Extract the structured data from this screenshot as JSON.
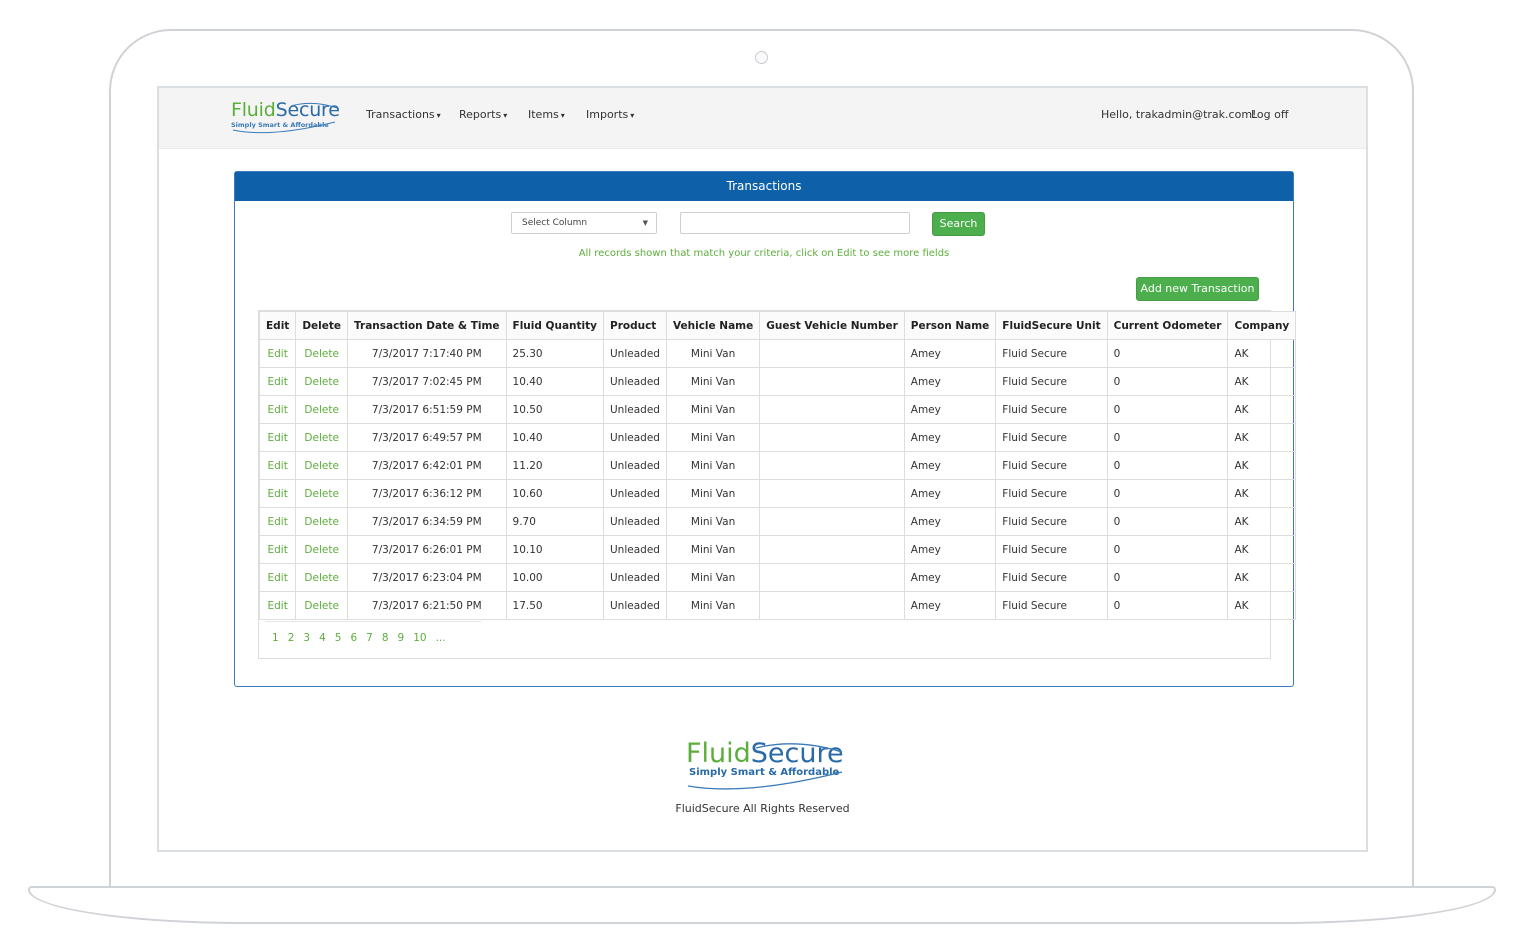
{
  "nav": {
    "logo_word_a": "Fluid",
    "logo_word_b": "Secure",
    "logo_tagline": "Simply Smart & Affordable",
    "menu": [
      "Transactions",
      "Reports",
      "Items",
      "Imports"
    ],
    "greeting": "Hello, trakadmin@trak.com!",
    "logoff": "Log off"
  },
  "panel": {
    "title": "Transactions",
    "select_column": "Select Column",
    "search_value": "",
    "search_button": "Search",
    "hint": "All records shown that match your criteria, click on Edit to see more fields",
    "add_button": "Add new Transaction"
  },
  "table": {
    "headers": [
      "Edit",
      "Delete",
      "Transaction Date & Time",
      "Fluid Quantity",
      "Product",
      "Vehicle Name",
      "Guest Vehicle Number",
      "Person Name",
      "FluidSecure Unit",
      "Current Odometer",
      "Company"
    ],
    "rows": [
      [
        "Edit",
        "Delete",
        "7/3/2017 7:17:40 PM",
        "25.30",
        "Unleaded",
        "Mini Van",
        "",
        "Amey",
        "Fluid Secure",
        "0",
        "AK"
      ],
      [
        "Edit",
        "Delete",
        "7/3/2017 7:02:45 PM",
        "10.40",
        "Unleaded",
        "Mini Van",
        "",
        "Amey",
        "Fluid Secure",
        "0",
        "AK"
      ],
      [
        "Edit",
        "Delete",
        "7/3/2017 6:51:59 PM",
        "10.50",
        "Unleaded",
        "Mini Van",
        "",
        "Amey",
        "Fluid Secure",
        "0",
        "AK"
      ],
      [
        "Edit",
        "Delete",
        "7/3/2017 6:49:57 PM",
        "10.40",
        "Unleaded",
        "Mini Van",
        "",
        "Amey",
        "Fluid Secure",
        "0",
        "AK"
      ],
      [
        "Edit",
        "Delete",
        "7/3/2017 6:42:01 PM",
        "11.20",
        "Unleaded",
        "Mini Van",
        "",
        "Amey",
        "Fluid Secure",
        "0",
        "AK"
      ],
      [
        "Edit",
        "Delete",
        "7/3/2017 6:36:12 PM",
        "10.60",
        "Unleaded",
        "Mini Van",
        "",
        "Amey",
        "Fluid Secure",
        "0",
        "AK"
      ],
      [
        "Edit",
        "Delete",
        "7/3/2017 6:34:59 PM",
        "9.70",
        "Unleaded",
        "Mini Van",
        "",
        "Amey",
        "Fluid Secure",
        "0",
        "AK"
      ],
      [
        "Edit",
        "Delete",
        "7/3/2017 6:26:01 PM",
        "10.10",
        "Unleaded",
        "Mini Van",
        "",
        "Amey",
        "Fluid Secure",
        "0",
        "AK"
      ],
      [
        "Edit",
        "Delete",
        "7/3/2017 6:23:04 PM",
        "10.00",
        "Unleaded",
        "Mini Van",
        "",
        "Amey",
        "Fluid Secure",
        "0",
        "AK"
      ],
      [
        "Edit",
        "Delete",
        "7/3/2017 6:21:50 PM",
        "17.50",
        "Unleaded",
        "Mini Van",
        "",
        "Amey",
        "Fluid Secure",
        "0",
        "AK"
      ]
    ],
    "pages": [
      "1",
      "2",
      "3",
      "4",
      "5",
      "6",
      "7",
      "8",
      "9",
      "10",
      "..."
    ]
  },
  "footer": {
    "logo_word_a": "Fluid",
    "logo_word_b": "Secure",
    "logo_tagline": "Simply Smart & Affordable",
    "copyright": "FluidSecure All Rights Reserved"
  },
  "colors": {
    "header_blue": "#0e61a9",
    "accent_green": "#4cae4c",
    "link_green": "#5cae3c",
    "brand_blue": "#2a6aa7"
  }
}
